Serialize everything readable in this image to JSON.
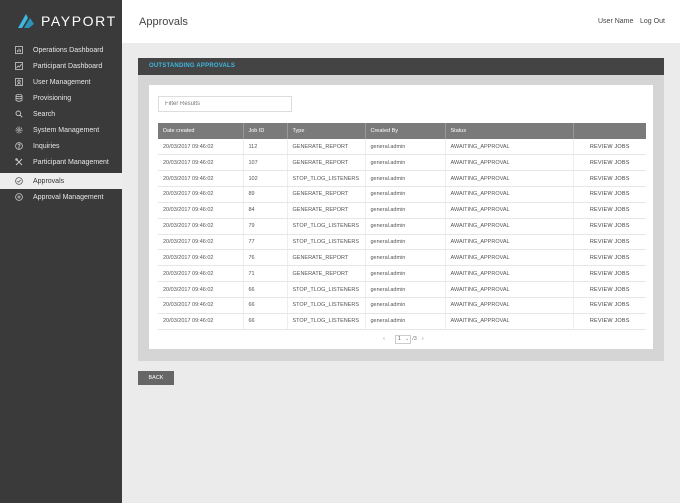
{
  "brand": {
    "name": "PAYPORT",
    "accent": "#3db8e0"
  },
  "sidebar": {
    "items": [
      {
        "label": "Operations Dashboard",
        "icon": "bar-chart-icon"
      },
      {
        "label": "Participant Dashboard",
        "icon": "line-chart-icon"
      },
      {
        "label": "User Management",
        "icon": "users-icon"
      },
      {
        "label": "Provisioning",
        "icon": "database-icon"
      },
      {
        "label": "Search",
        "icon": "search-icon"
      },
      {
        "label": "System Management",
        "icon": "gear-icon"
      },
      {
        "label": "Inquiries",
        "icon": "question-icon"
      },
      {
        "label": "Participant Management",
        "icon": "tools-icon"
      },
      {
        "label": "Approvals",
        "icon": "check-circle-icon",
        "active": true
      },
      {
        "label": "Approval Management",
        "icon": "plus-circle-icon"
      }
    ]
  },
  "header": {
    "title": "Approvals",
    "user_name": "User Name",
    "logout": "Log Out"
  },
  "panel": {
    "title": "OUTSTANDING APPROVALS"
  },
  "filter": {
    "placeholder": "Filter Results"
  },
  "table": {
    "columns": [
      "Date created",
      "Job ID",
      "Type",
      "Created By",
      "Status",
      ""
    ],
    "rows": [
      [
        "20/03/2017 09:46:02",
        "112",
        "GENERATE_REPORT",
        "general.admin",
        "AWAITING_APPROVAL",
        "REVIEW JOBS"
      ],
      [
        "20/03/2017 09:46:02",
        "107",
        "GENERATE_REPORT",
        "general.admin",
        "AWAITING_APPROVAL",
        "REVIEW JOBS"
      ],
      [
        "20/03/2017 09:46:02",
        "102",
        "STOP_TLOG_LISTENERS",
        "general.admin",
        "AWAITING_APPROVAL",
        "REVIEW JOBS"
      ],
      [
        "20/03/2017 09:46:02",
        "89",
        "GENERATE_REPORT",
        "general.admin",
        "AWAITING_APPROVAL",
        "REVIEW JOBS"
      ],
      [
        "20/03/2017 09:46:02",
        "84",
        "GENERATE_REPORT",
        "general.admin",
        "AWAITING_APPROVAL",
        "REVIEW JOBS"
      ],
      [
        "20/03/2017 09:46:02",
        "79",
        "STOP_TLOG_LISTENERS",
        "general.admin",
        "AWAITING_APPROVAL",
        "REVIEW JOBS"
      ],
      [
        "20/03/2017 09:46:02",
        "77",
        "STOP_TLOG_LISTENERS",
        "general.admin",
        "AWAITING_APPROVAL",
        "REVIEW JOBS"
      ],
      [
        "20/03/2017 09:46:02",
        "76",
        "GENERATE_REPORT",
        "general.admin",
        "AWAITING_APPROVAL",
        "REVIEW JOBS"
      ],
      [
        "20/03/2017 09:46:02",
        "71",
        "GENERATE_REPORT",
        "general.admin",
        "AWAITING_APPROVAL",
        "REVIEW JOBS"
      ],
      [
        "20/03/2017 09:46:02",
        "66",
        "STOP_TLOG_LISTENERS",
        "general.admin",
        "AWAITING_APPROVAL",
        "REVIEW JOBS"
      ],
      [
        "20/03/2017 09:46:02",
        "66",
        "STOP_TLOG_LISTENERS",
        "general.admin",
        "AWAITING_APPROVAL",
        "REVIEW JOBS"
      ],
      [
        "20/03/2017 09:46:02",
        "66",
        "STOP_TLOG_LISTENERS",
        "general.admin",
        "AWAITING_APPROVAL",
        "REVIEW JOBS"
      ]
    ]
  },
  "pagination": {
    "prev": "‹",
    "current": "1",
    "total": "/3",
    "next": "›"
  },
  "back_button": {
    "label": "BACK"
  }
}
